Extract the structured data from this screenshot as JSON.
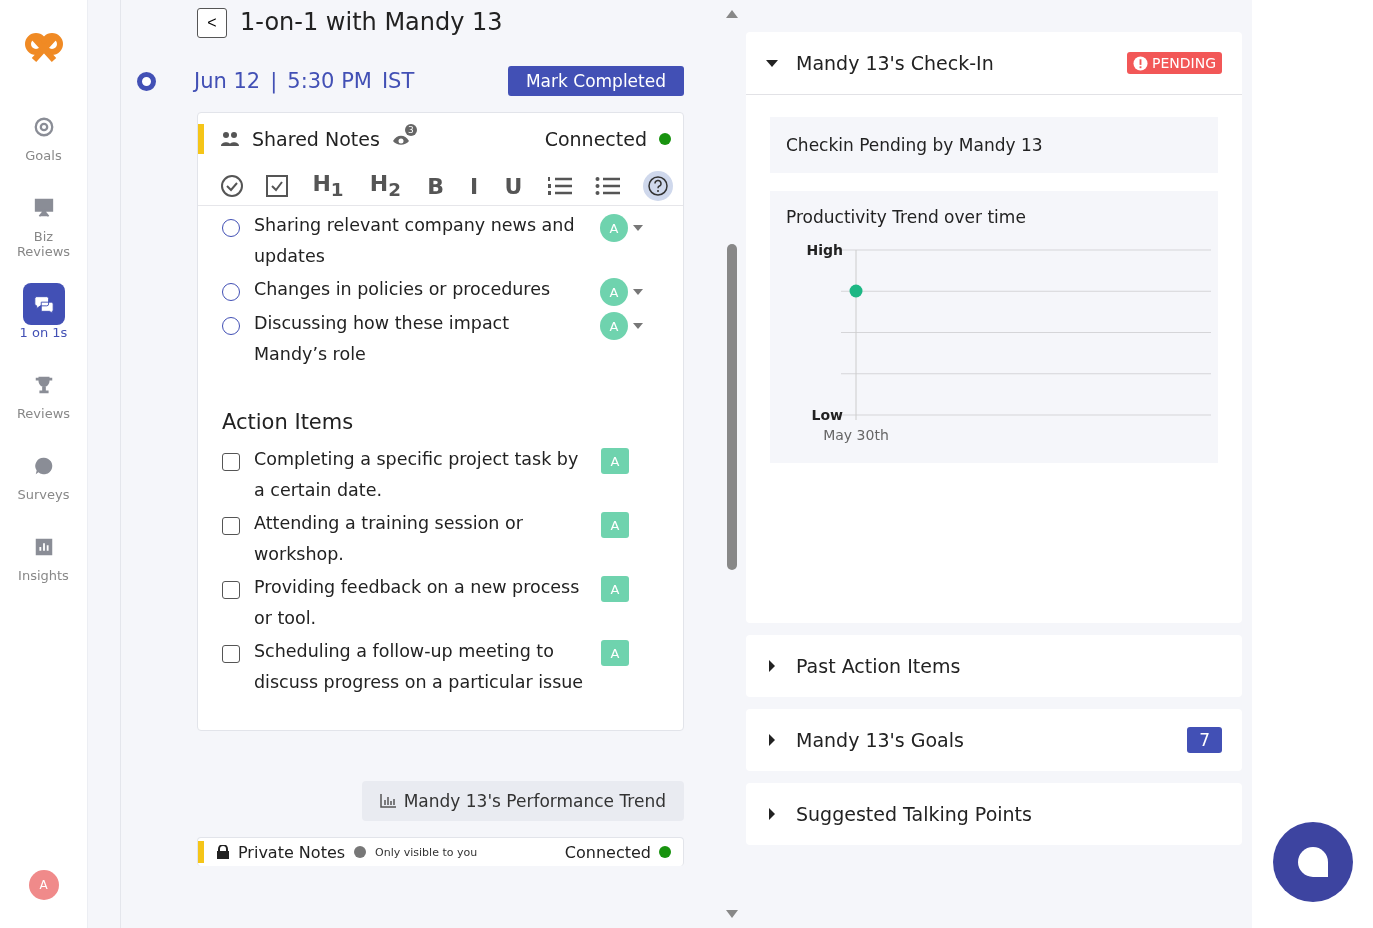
{
  "sidebar": {
    "items": [
      {
        "label": "Goals",
        "selected": false
      },
      {
        "label": "Biz Reviews",
        "selected": false
      },
      {
        "label": "1 on 1s",
        "selected": true
      },
      {
        "label": "Reviews",
        "selected": false
      },
      {
        "label": "Surveys",
        "selected": false
      },
      {
        "label": "Insights",
        "selected": false
      }
    ],
    "avatar": "A"
  },
  "header": {
    "back": "<",
    "title": "1-on-1 with Mandy 13"
  },
  "meeting": {
    "date": "Jun 12",
    "separator": "|",
    "time": "5:30 PM",
    "timezone": "IST",
    "action": "Mark Completed"
  },
  "shared_notes": {
    "title": "Shared Notes",
    "viewers": "3",
    "status": "Connected",
    "connected": true,
    "toolbar": [
      {
        "kind": "check-circle"
      },
      {
        "kind": "checkbox"
      },
      {
        "kind": "text",
        "label": "H$_{1}$"
      },
      {
        "kind": "text",
        "label": "H$_{2}$"
      },
      {
        "kind": "text",
        "label": "B"
      },
      {
        "kind": "text",
        "label": "I"
      },
      {
        "kind": "text",
        "label": "U"
      },
      {
        "kind": "ordered-list"
      },
      {
        "kind": "bullet-list"
      },
      {
        "kind": "help"
      }
    ],
    "talking_points": [
      {
        "text": "Sharing relevant company news and updates",
        "checked": false,
        "assignee": "A"
      },
      {
        "text": "Changes in policies or procedures",
        "checked": false,
        "assignee": "A"
      },
      {
        "text": "Discussing how these impact Mandy’s role",
        "checked": false,
        "assignee": "A"
      }
    ],
    "action_heading": "Action Items",
    "action_items": [
      {
        "text": "Completing a specific project task by a certain date.",
        "checked": false,
        "assignee": "A"
      },
      {
        "text": "Attending a training session or workshop.",
        "checked": false,
        "assignee": "A"
      },
      {
        "text": "Providing feedback on a new process or tool.",
        "checked": false,
        "assignee": "A"
      },
      {
        "text": "Scheduling a follow-up meeting to discuss progress on a particular issue",
        "checked": false,
        "assignee": "A"
      }
    ]
  },
  "trend_button": "Mandy 13's Performance Trend",
  "private_notes": {
    "title": "Private Notes",
    "note": "Only visible to you",
    "status": "Connected",
    "connected": true
  },
  "panels": [
    {
      "title": "Mandy 13's Check-In",
      "expanded": true,
      "badge": {
        "kind": "pending",
        "label": "PENDING"
      },
      "message": "Checkin Pending by Mandy 13",
      "chart": {
        "title": "Productivity Trend over time",
        "y_labels": [
          "High",
          "Low"
        ],
        "x_labels": [
          "May 30th"
        ]
      }
    },
    {
      "title": "Past Action Items",
      "expanded": false
    },
    {
      "title": "Mandy 13's Goals",
      "expanded": false,
      "badge": {
        "kind": "count",
        "label": "7"
      }
    },
    {
      "title": "Suggested Talking Points",
      "expanded": false
    }
  ]
}
